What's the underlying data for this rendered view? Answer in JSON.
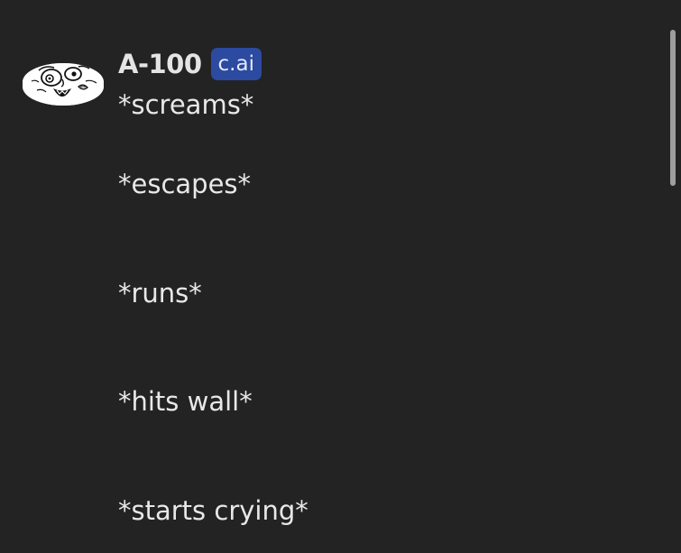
{
  "message": {
    "character_name": "A-100",
    "badge": "c.ai",
    "lines": [
      "*screams*",
      "*escapes*",
      "*runs*",
      "*hits wall*",
      "*starts crying*"
    ]
  },
  "avatar": {
    "icon": "meme-face-avatar"
  },
  "colors": {
    "background": "#232323",
    "badge": "#2b4aa0",
    "text": "#e8e8e8"
  }
}
